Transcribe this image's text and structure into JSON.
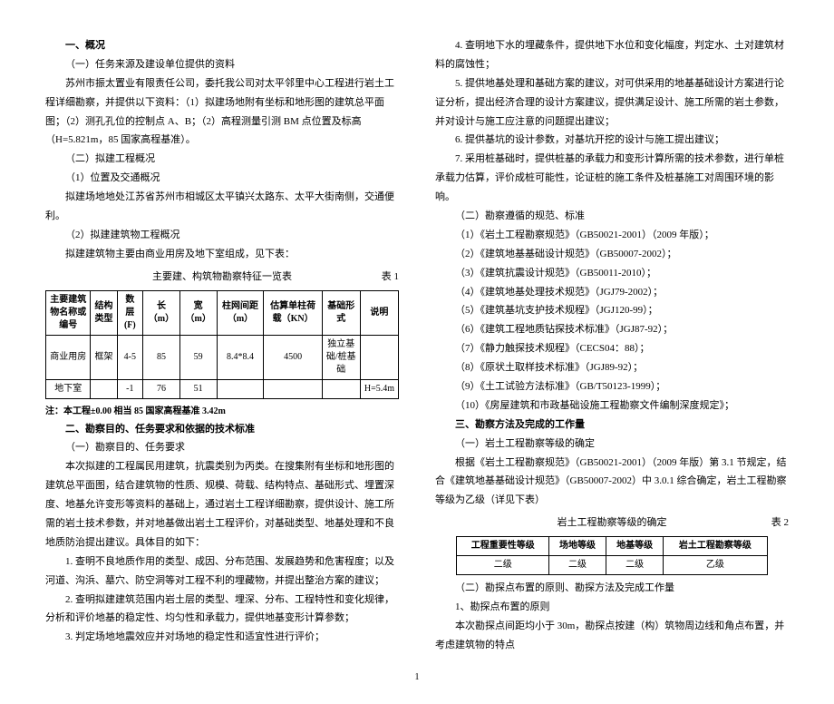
{
  "left": {
    "h1": "一、概况",
    "s1_1": "（一）任务来源及建设单位提供的资料",
    "p1": "苏州市振太置业有限责任公司，委托我公司对太平邻里中心工程进行岩土工程详细勘察，并提供以下资料：（1）拟建场地附有坐标和地形图的建筑总平面图；（2）测孔孔位的控制点 A、B；（2）高程测量引测 BM 点位置及标高（H=5.821m，85 国家高程基准）。",
    "s1_2": "（二）拟建工程概况",
    "s1_2_1": "（1）位置及交通概况",
    "p2": "拟建场地地处江苏省苏州市相城区太平镇兴太路东、太平大街南侧，交通便利。",
    "s1_2_2": "（2）拟建建筑物工程概况",
    "p3": "拟建建筑物主要由商业用房及地下室组成，见下表：",
    "t1_cap": "主要建、构筑物勘察特征一览表",
    "t1_num": "表 1",
    "t1_head": [
      "主要建筑物名称或编号",
      "结构类型",
      "数层(F)",
      "长（m）",
      "宽（m）",
      "柱网间距（m）",
      "估算单柱荷载（KN）",
      "基础形式",
      "说明"
    ],
    "t1_r1": [
      "商业用房",
      "框架",
      "4-5",
      "85",
      "59",
      "8.4*8.4",
      "4500",
      "独立基础/桩基础",
      ""
    ],
    "t1_r2": [
      "地下室",
      "",
      "-1",
      "76",
      "51",
      "",
      "",
      "",
      "H=5.4m"
    ],
    "note": "注：本工程±0.00 相当 85 国家高程基准 3.42m",
    "h2": "二、勘察目的、任务要求和依据的技术标准",
    "s2_1": "（一）勘察目的、任务要求",
    "p4": "本次拟建的工程属民用建筑，抗震类别为丙类。在搜集附有坐标和地形图的建筑总平面图，结合建筑物的性质、规模、荷载、结构特点、基础形式、埋置深度、地基允许变形等资料的基础上，通过岩土工程详细勘察，提供设计、施工所需的岩土技术参数，并对地基做出岩土工程评价，对基础类型、地基处理和不良地质防治提出建议。具体目的如下：",
    "li1": "1. 查明不良地质作用的类型、成因、分布范围、发展趋势和危害程度；以及河道、沟浜、墓穴、防空洞等对工程不利的埋藏物，并提出整治方案的建议；",
    "li2": "2. 查明拟建建筑范围内岩土层的类型、埋深、分布、工程特性和变化规律，分析和评价地基的稳定性、均匀性和承载力，提供地基变形计算参数；",
    "li3": "3. 判定场地地震效应并对场地的稳定性和适宜性进行评价；"
  },
  "right": {
    "li4": "4. 查明地下水的埋藏条件，提供地下水位和变化幅度，判定水、土对建筑材料的腐蚀性；",
    "li5": "5. 提供地基处理和基础方案的建议，对可供采用的地基基础设计方案进行论证分析，提出经济合理的设计方案建议，提供满足设计、施工所需的岩土参数，并对设计与施工应注意的问题提出建议；",
    "li6": "6. 提供基坑的设计参数，对基坑开挖的设计与施工提出建议；",
    "li7": "7. 采用桩基础时，提供桩基的承载力和变形计算所需的技术参数，进行单桩承载力估算，评价成桩可能性，论证桩的施工条件及桩基施工对周围环境的影响。",
    "s2_2": "（二）勘察遵循的规范、标准",
    "std1": "（1）《岩土工程勘察规范》（GB50021-2001）（2009 年版）；",
    "std2": "（2）《建筑地基基础设计规范》（GB50007-2002）；",
    "std3": "（3）《建筑抗震设计规范》（GB50011-2010）；",
    "std4": "（4）《建筑地基处理技术规范》（JGJ79-2002）；",
    "std5": "（5）《建筑基坑支护技术规程》（JGJ120-99）；",
    "std6": "（6）《建筑工程地质钻探技术标准》（JGJ87-92）；",
    "std7": "（7）《静力触探技术规程》（CECS04：88）；",
    "std8": "（8）《原状土取样技术标准》（JGJ89-92）；",
    "std9": "（9）《土工试验方法标准》（GB/T50123-1999）；",
    "std10": "（10）《房屋建筑和市政基础设施工程勘察文件编制深度规定》；",
    "h3": "三、勘察方法及完成的工作量",
    "s3_1": "（一）岩土工程勘察等级的确定",
    "p5": "根据《岩土工程勘察规范》（GB50021-2001）（2009 年版）第 3.1 节规定，结合《建筑地基基础设计规范》（GB50007-2002）中 3.0.1 综合确定，岩土工程勘察等级为乙级（详见下表）",
    "t2_cap": "岩土工程勘察等级的确定",
    "t2_num": "表 2",
    "t2_head": [
      "工程重要性等级",
      "场地等级",
      "地基等级",
      "岩土工程勘察等级"
    ],
    "t2_row": [
      "二级",
      "二级",
      "二级",
      "乙级"
    ],
    "s3_2": "（二）勘探点布置的原则、勘探方法及完成工作量",
    "s3_2_1": "1、勘探点布置的原则",
    "p6": "本次勘探点间距均小于 30m，勘探点按建（构）筑物周边线和角点布置，并考虑建筑物的特点"
  },
  "page": "1"
}
